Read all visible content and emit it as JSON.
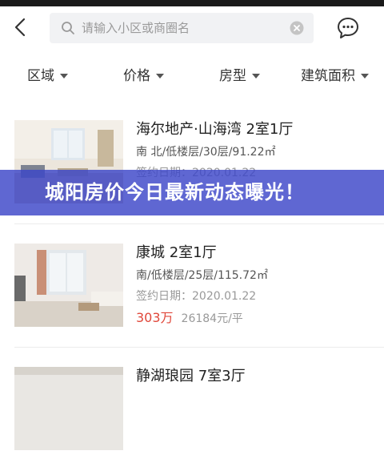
{
  "search": {
    "placeholder": "请输入小区或商圈名"
  },
  "filters": [
    "区域",
    "价格",
    "房型",
    "建筑面积"
  ],
  "listings": [
    {
      "title": "海尔地产·山海湾 2室1厅",
      "meta": "南 北/低楼层/30层/91.22㎡",
      "sign": "签约日期：2020.01.22",
      "price": "",
      "unit_price": ""
    },
    {
      "title": "康城 2室1厅",
      "meta": "南/低楼层/25层/115.72㎡",
      "sign": "签约日期：2020.01.22",
      "price": "303万",
      "unit_price": "26184元/平"
    },
    {
      "title": "静湖琅园 7室3厅",
      "meta": "",
      "sign": "",
      "price": "",
      "unit_price": ""
    }
  ],
  "banner": {
    "text": "城阳房价今日最新动态曝光！"
  },
  "colors": {
    "price": "#e0473a",
    "banner": "#3c46c8"
  },
  "icons": [
    "back-arrow-icon",
    "search-icon",
    "clear-icon",
    "chat-bubble-icon",
    "dropdown-caret-icon"
  ]
}
